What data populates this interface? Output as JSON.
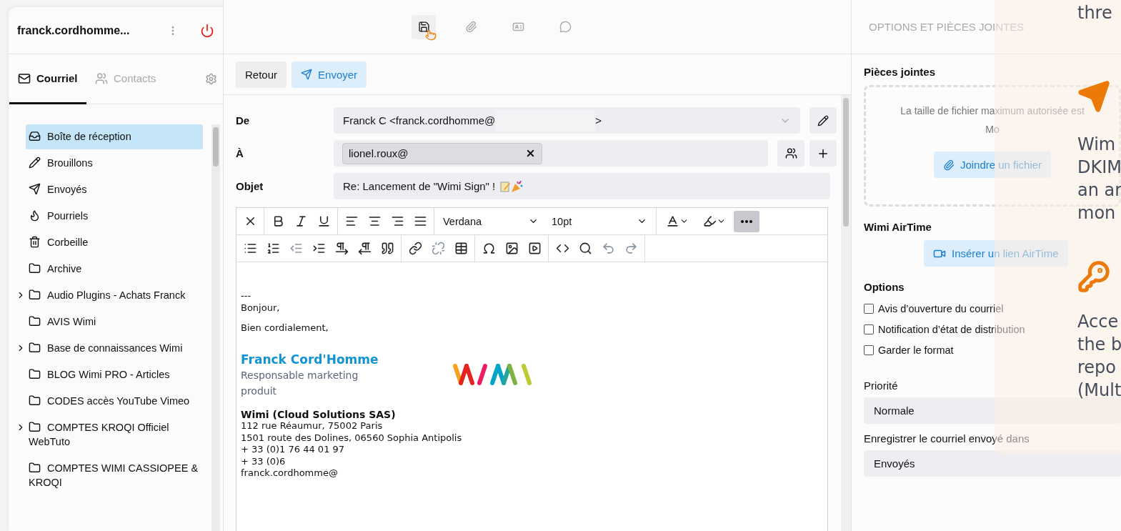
{
  "account": {
    "name": "franck.cordhomme..."
  },
  "sidebar_tabs": [
    {
      "label": "Courriel",
      "selected": true
    },
    {
      "label": "Contacts",
      "selected": false
    }
  ],
  "folders": [
    {
      "label": "Boîte de réception",
      "kind": "inbox",
      "expandable": false,
      "selected": true
    },
    {
      "label": "Brouillons",
      "kind": "drafts",
      "expandable": false,
      "selected": false
    },
    {
      "label": "Envoyés",
      "kind": "sent",
      "expandable": false,
      "selected": false
    },
    {
      "label": "Pourriels",
      "kind": "spam",
      "expandable": false,
      "selected": false
    },
    {
      "label": "Corbeille",
      "kind": "trash",
      "expandable": false,
      "selected": false
    },
    {
      "label": "Archive",
      "kind": "folder",
      "expandable": false,
      "selected": false
    },
    {
      "label": "Audio Plugins - Achats Franck",
      "kind": "folder",
      "expandable": true,
      "selected": false
    },
    {
      "label": "AVIS Wimi",
      "kind": "folder",
      "expandable": false,
      "selected": false
    },
    {
      "label": "Base de connaissances Wimi",
      "kind": "folder",
      "expandable": true,
      "selected": false
    },
    {
      "label": "BLOG Wimi PRO - Articles",
      "kind": "folder",
      "expandable": false,
      "selected": false
    },
    {
      "label": "CODES accès YouTube Vimeo",
      "kind": "folder",
      "expandable": false,
      "selected": false
    },
    {
      "label": "COMPTES KROQI Officiel WebTuto",
      "kind": "folder",
      "expandable": true,
      "selected": false
    },
    {
      "label": "COMPTES WIMI CASSIOPEE & KROQI",
      "kind": "folder",
      "expandable": false,
      "selected": false
    }
  ],
  "top_toolbar": [
    {
      "kind": "save",
      "hovered": true
    },
    {
      "kind": "attach",
      "hovered": false
    },
    {
      "kind": "contact-card",
      "hovered": false
    },
    {
      "kind": "comment",
      "hovered": false
    }
  ],
  "actions": {
    "back": "Retour",
    "send": "Envoyer"
  },
  "compose": {
    "from": {
      "label": "De",
      "value": "Franck C <franck.cordhomme@",
      "value_end": ">"
    },
    "to": {
      "label": "À",
      "recipients": [
        "lionel.roux@"
      ]
    },
    "subject": {
      "label": "Objet",
      "value": "Re: Lancement de \"Wimi Sign\" !"
    }
  },
  "editor_toolbar": {
    "font": "Verdana",
    "size": "10pt",
    "more_selected": true
  },
  "body": {
    "separator": "---",
    "greeting": "Bonjour,",
    "closing": "Bien cordialement,",
    "signature": {
      "name": "Franck Cord'Homme",
      "title": "Responsable marketing produit",
      "company": "Wimi (Cloud Solutions SAS)",
      "lines": [
        "112 rue Réaumur, 75002 Paris",
        "1501 route des Dolines, 06560 Sophia Antipolis",
        "+ 33 (0)1 76 44 01 97",
        "+ 33 (0)6",
        "franck.cordhomme@"
      ]
    }
  },
  "options_panel": {
    "title": "OPTIONS ET PIÈCES JOINTES",
    "attachments_heading": "Pièces jointes",
    "size_note": "La taille de fichier maximum autorisée est",
    "size_unit": "Mo",
    "attach_button": "Joindre un fichier",
    "airtime_heading": "Wimi AirTime",
    "airtime_button": "Insérer un lien AirTime",
    "options_heading": "Options",
    "options": [
      {
        "label": "Avis d’ouverture du courriel",
        "checked": false
      },
      {
        "label": "Notification d’état de distribution",
        "checked": false
      },
      {
        "label": "Garder le format",
        "checked": false
      }
    ],
    "priority_label": "Priorité",
    "priority_value": "Normale",
    "save_in_label": "Enregistrer le courriel envoyé dans",
    "save_in_value": "Envoyés"
  },
  "overlay": {
    "top_text": "thre",
    "blocks": [
      {
        "kind": "send",
        "lines": [
          "Wim",
          "DKIM",
          "an ar",
          "mon"
        ]
      },
      {
        "kind": "key",
        "lines": [
          "Acce",
          "the b",
          "repo",
          "(Mult"
        ]
      }
    ]
  }
}
